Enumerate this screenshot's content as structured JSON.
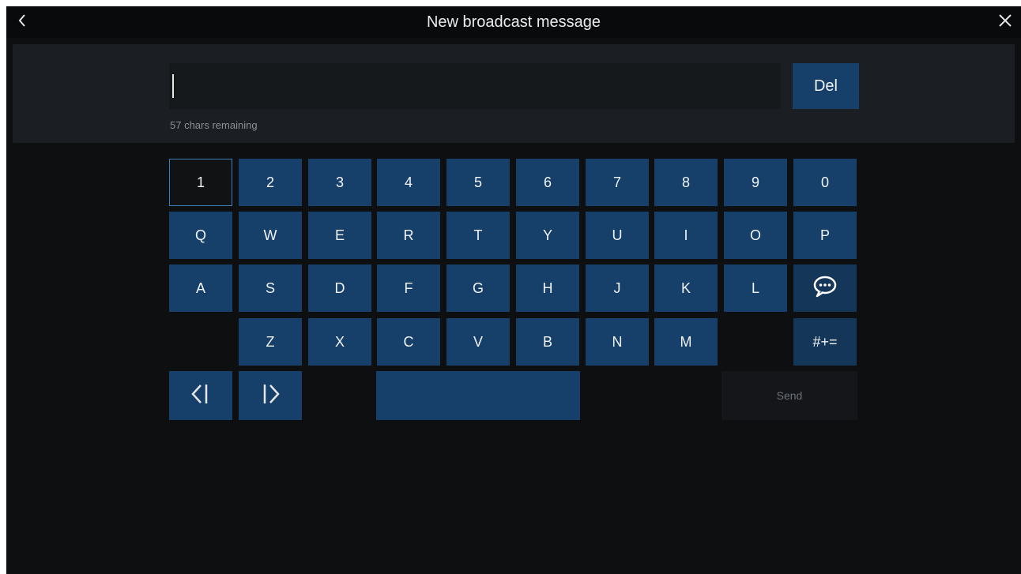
{
  "header": {
    "title": "New broadcast message",
    "back_icon": "chevron-left-icon",
    "close_icon": "close-icon"
  },
  "message": {
    "value": "",
    "chars_remaining": "57 chars remaining",
    "delete_label": "Del"
  },
  "keyboard": {
    "row_numbers": [
      "1",
      "2",
      "3",
      "4",
      "5",
      "6",
      "7",
      "8",
      "9",
      "0"
    ],
    "row_top": [
      "Q",
      "W",
      "E",
      "R",
      "T",
      "Y",
      "U",
      "I",
      "O",
      "P"
    ],
    "row_middle": [
      "A",
      "S",
      "D",
      "F",
      "G",
      "H",
      "J",
      "K",
      "L"
    ],
    "row_bottom": [
      "Z",
      "X",
      "C",
      "V",
      "B",
      "N",
      "M"
    ],
    "symbols_label": "#+=",
    "send_label": "Send",
    "emoji_icon": "speech-bubble-icon",
    "cursor_left_icon": "cursor-left-icon",
    "cursor_right_icon": "cursor-right-icon",
    "selected_key": "1"
  },
  "colors": {
    "background": "#0e0f10",
    "key": "#16406a",
    "selected_border": "#3b7fb8",
    "text": "#f0f4f8"
  }
}
